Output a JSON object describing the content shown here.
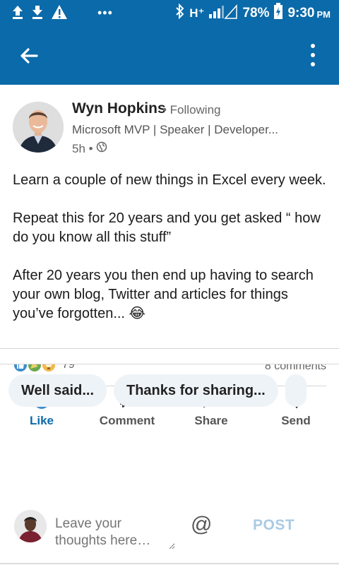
{
  "status_bar": {
    "icons": [
      "upload-icon",
      "download-icon",
      "warning-icon",
      "more-notifications-icon",
      "bluetooth-icon",
      "network-icon",
      "signal-icon",
      "battery-icon"
    ],
    "network": "H⁺",
    "battery": "78%",
    "time": "9:30",
    "ampm": "PM"
  },
  "app_bar": {
    "icons": [
      "back-arrow-icon",
      "overflow-menu-icon"
    ]
  },
  "post": {
    "author": "Wyn Hopkins",
    "follow_status": "• Following",
    "headline": "Microsoft MVP | Speaker | Developer...",
    "time_ago": "5h •",
    "visibility_icon": "globe-icon",
    "paragraphs": [
      "Learn a couple of new things in Excel every week.",
      "Repeat this for 20 years and you get asked “ how do you know all this stuff”",
      "After 20 years you then end up having to search your own blog, Twitter and articles for things you’ve forgotten... 😂"
    ],
    "reaction_icons": [
      "like-reaction-icon",
      "celebrate-reaction-icon",
      "insightful-reaction-icon"
    ],
    "reaction_count": "79",
    "comments_count": "8 comments"
  },
  "actions": [
    {
      "label": "Like",
      "icon": "like-icon"
    },
    {
      "label": "Comment",
      "icon": "comment-icon"
    },
    {
      "label": "Share",
      "icon": "share-icon"
    },
    {
      "label": "Send",
      "icon": "send-icon"
    }
  ],
  "suggestions": [
    "Well said...",
    "Thanks for sharing..."
  ],
  "composer": {
    "placeholder": "Leave your thoughts here…",
    "mention_icon": "at-icon",
    "post_label": "POST"
  },
  "colors": {
    "brand": "#0b6aa9",
    "chip_bg": "#eef3f8",
    "post_disabled": "#a9cbe3"
  }
}
